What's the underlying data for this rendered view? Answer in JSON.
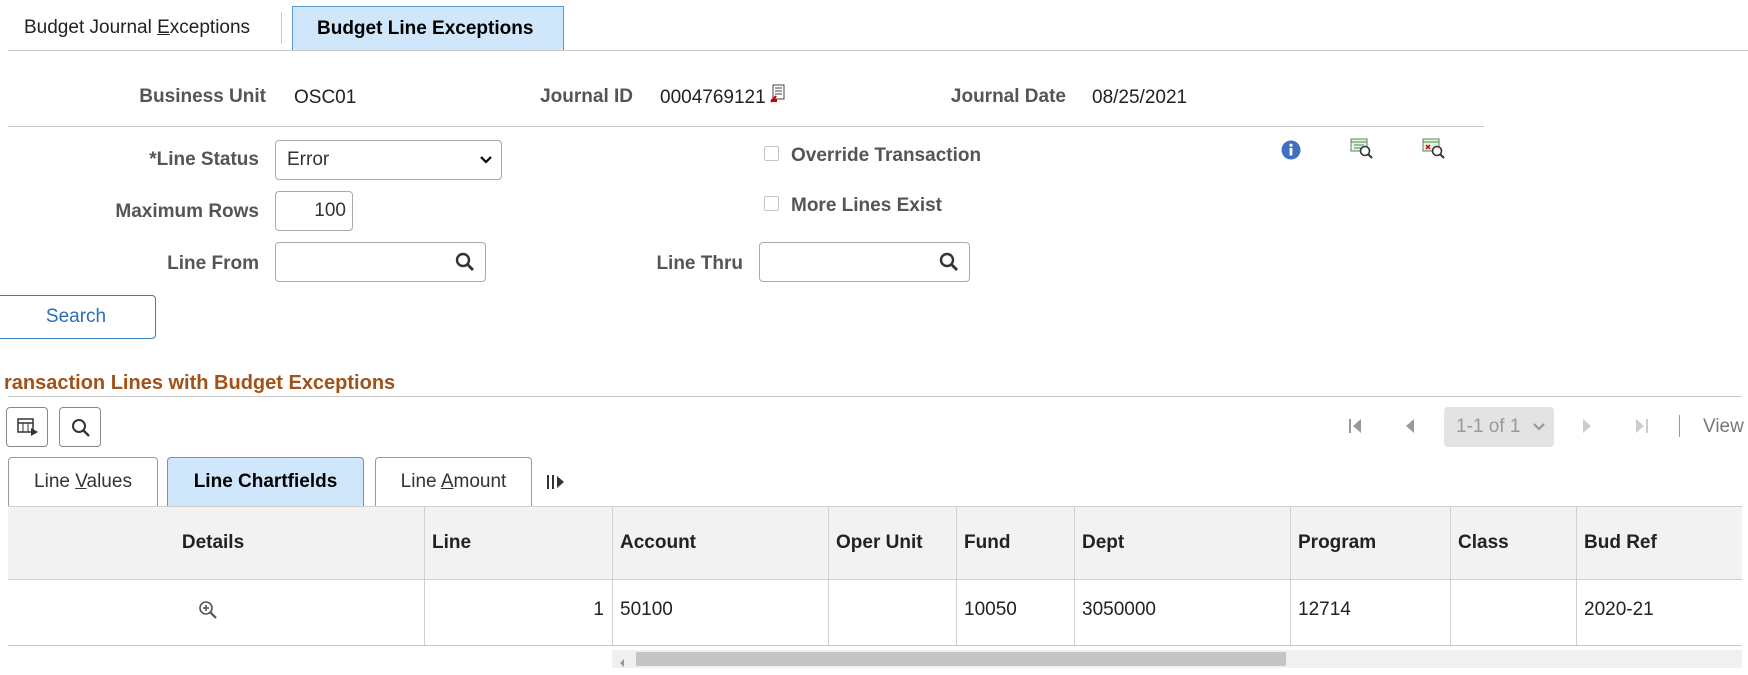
{
  "tabs": [
    {
      "pre": "Budget Journal ",
      "ul": "E",
      "post": "xceptions"
    },
    {
      "label": "Budget Line Exceptions"
    }
  ],
  "header": {
    "business_unit_label": "Business Unit",
    "business_unit": "OSC01",
    "journal_id_label": "Journal ID",
    "journal_id": "0004769121",
    "journal_date_label": "Journal Date",
    "journal_date": "08/25/2021"
  },
  "filters": {
    "line_status_label": "*Line Status",
    "line_status": "Error",
    "max_rows_label": "Maximum Rows",
    "max_rows": "100",
    "line_from_label": "Line From",
    "line_thru_label": "Line Thru",
    "override_label": "Override Transaction",
    "more_lines_label": "More Lines Exist",
    "search_label": "Search"
  },
  "section": {
    "title": "ransaction Lines with Budget Exceptions"
  },
  "pager": {
    "range": "1-1 of 1",
    "view": "View"
  },
  "grid_tabs": [
    {
      "pre": "Line ",
      "ul": "V",
      "post": "alues"
    },
    {
      "label": "Line Chartfields"
    },
    {
      "pre": "Line ",
      "ul": "A",
      "post": "mount"
    }
  ],
  "grid": {
    "columns": [
      "Details",
      "Line",
      "Account",
      "Oper Unit",
      "Fund",
      "Dept",
      "Program",
      "Class",
      "Bud Ref"
    ],
    "rows": [
      {
        "line": "1",
        "account": "50100",
        "oper_unit": "",
        "fund": "10050",
        "dept": "3050000",
        "program": "12714",
        "class": "",
        "bud_ref": "2020-21"
      }
    ]
  },
  "colors": {
    "accent": "#2a6cb8",
    "active_tab": "#cfe6fb",
    "section_title": "#a0521a"
  },
  "icons": [
    "info-icon",
    "lookup-icon",
    "chevron-down-icon",
    "zoom-in-icon",
    "personalize-icon",
    "report-icon"
  ]
}
